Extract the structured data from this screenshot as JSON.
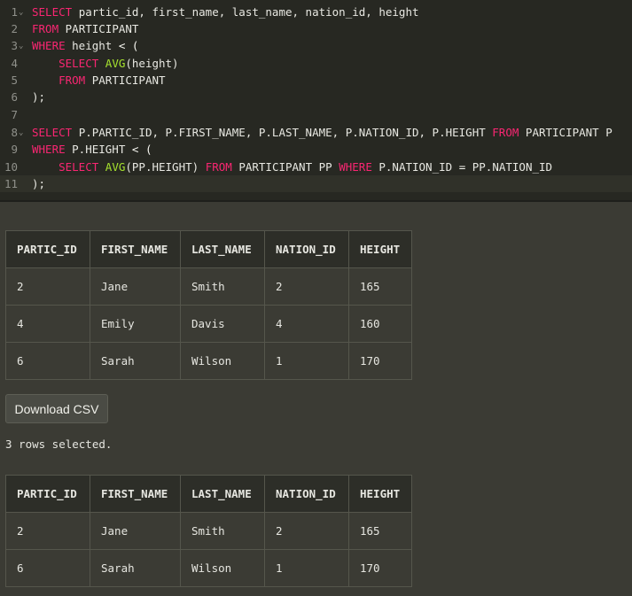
{
  "editor": {
    "lines": [
      {
        "num": "1",
        "fold": true,
        "tokens": [
          [
            "kw",
            "SELECT "
          ],
          [
            "pl",
            "partic_id, first_name, last_name, nation_id, height"
          ]
        ]
      },
      {
        "num": "2",
        "fold": false,
        "tokens": [
          [
            "kw",
            "FROM "
          ],
          [
            "pl",
            "PARTICIPANT"
          ]
        ]
      },
      {
        "num": "3",
        "fold": true,
        "tokens": [
          [
            "kw",
            "WHERE "
          ],
          [
            "pl",
            "height "
          ],
          [
            "op",
            "< ("
          ]
        ]
      },
      {
        "num": "4",
        "fold": false,
        "tokens": [
          [
            "pl",
            "    "
          ],
          [
            "kw",
            "SELECT "
          ],
          [
            "fn",
            "AVG"
          ],
          [
            "pl",
            "(height)"
          ]
        ]
      },
      {
        "num": "5",
        "fold": false,
        "tokens": [
          [
            "pl",
            "    "
          ],
          [
            "kw",
            "FROM "
          ],
          [
            "pl",
            "PARTICIPANT"
          ]
        ]
      },
      {
        "num": "6",
        "fold": false,
        "tokens": [
          [
            "pl",
            ");"
          ]
        ]
      },
      {
        "num": "7",
        "fold": false,
        "tokens": []
      },
      {
        "num": "8",
        "fold": true,
        "tokens": [
          [
            "kw",
            "SELECT "
          ],
          [
            "pl",
            "P.PARTIC_ID, P.FIRST_NAME, P.LAST_NAME, P.NATION_ID, P.HEIGHT "
          ],
          [
            "kw",
            "FROM "
          ],
          [
            "pl",
            "PARTICIPANT P"
          ]
        ]
      },
      {
        "num": "9",
        "fold": false,
        "tokens": [
          [
            "kw",
            "WHERE "
          ],
          [
            "pl",
            "P.HEIGHT "
          ],
          [
            "op",
            "< ("
          ]
        ]
      },
      {
        "num": "10",
        "fold": false,
        "tokens": [
          [
            "pl",
            "    "
          ],
          [
            "kw",
            "SELECT "
          ],
          [
            "fn",
            "AVG"
          ],
          [
            "pl",
            "(PP.HEIGHT) "
          ],
          [
            "kw",
            "FROM "
          ],
          [
            "pl",
            "PARTICIPANT PP "
          ],
          [
            "kw",
            "WHERE "
          ],
          [
            "pl",
            "P.NATION_ID "
          ],
          [
            "op",
            "= "
          ],
          [
            "pl",
            "PP.NATION_ID"
          ]
        ]
      },
      {
        "num": "11",
        "fold": false,
        "active": true,
        "tokens": [
          [
            "pl",
            ");"
          ]
        ]
      }
    ]
  },
  "result1": {
    "columns": [
      "PARTIC_ID",
      "FIRST_NAME",
      "LAST_NAME",
      "NATION_ID",
      "HEIGHT"
    ],
    "rows": [
      [
        "2",
        "Jane",
        "Smith",
        "2",
        "165"
      ],
      [
        "4",
        "Emily",
        "Davis",
        "4",
        "160"
      ],
      [
        "6",
        "Sarah",
        "Wilson",
        "1",
        "170"
      ]
    ]
  },
  "download_label": "Download CSV",
  "status_text": "3 rows selected.",
  "result2": {
    "columns": [
      "PARTIC_ID",
      "FIRST_NAME",
      "LAST_NAME",
      "NATION_ID",
      "HEIGHT"
    ],
    "rows": [
      [
        "2",
        "Jane",
        "Smith",
        "2",
        "165"
      ],
      [
        "6",
        "Sarah",
        "Wilson",
        "1",
        "170"
      ]
    ]
  }
}
